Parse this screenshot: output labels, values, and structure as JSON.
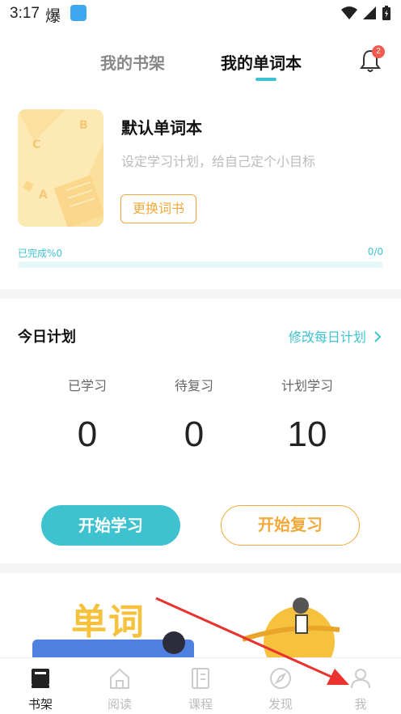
{
  "status_bar": {
    "time": "3:17",
    "extra_glyph": "爆"
  },
  "header": {
    "tabs": [
      {
        "label": "我的书架",
        "active": false
      },
      {
        "label": "我的单词本",
        "active": true
      }
    ],
    "notification_count": "2",
    "accent": "#3fc2cf"
  },
  "wordbook": {
    "title": "默认单词本",
    "subtitle": "设定学习计划，给自己定个小目标",
    "change_button": "更换词书",
    "cover_letters": [
      "B",
      "C",
      "A"
    ],
    "progress_label": "已完成%0",
    "progress_count": "0/0",
    "progress_fraction": 0
  },
  "plan": {
    "title": "今日计划",
    "edit_link": "修改每日计划",
    "stats": [
      {
        "label": "已学习",
        "value": "0"
      },
      {
        "label": "待复习",
        "value": "0"
      },
      {
        "label": "计划学习",
        "value": "10"
      }
    ],
    "start_button": "开始学习",
    "review_button": "开始复习"
  },
  "banner": {
    "headline": "单词"
  },
  "bottom_nav": [
    {
      "label": "书架",
      "icon": "book-icon",
      "active": true
    },
    {
      "label": "阅读",
      "icon": "home-icon",
      "active": false
    },
    {
      "label": "课程",
      "icon": "course-icon",
      "active": false
    },
    {
      "label": "发现",
      "icon": "compass-icon",
      "active": false
    },
    {
      "label": "我",
      "icon": "profile-icon",
      "active": false
    }
  ],
  "colors": {
    "teal": "#3fc2cf",
    "orange": "#f2a93b",
    "badge_red": "#f25a4d",
    "annotation_red": "#e8332e"
  }
}
